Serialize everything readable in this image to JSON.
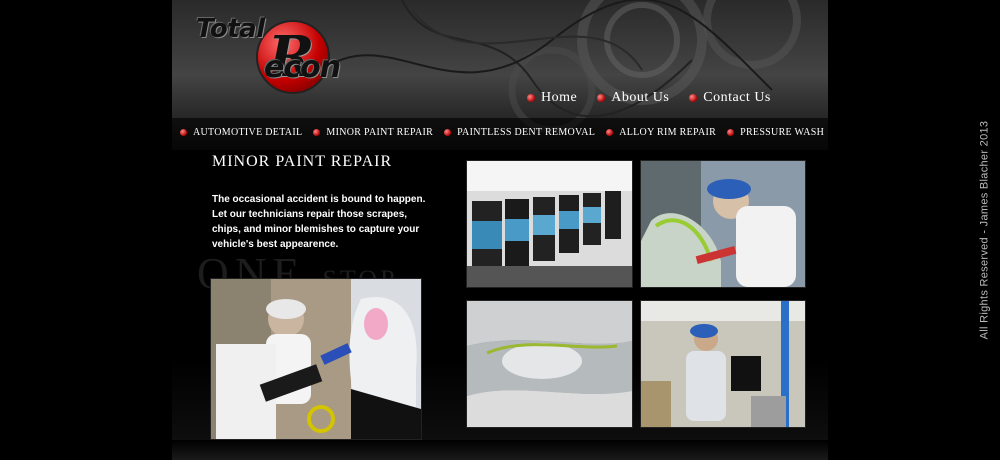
{
  "logo": {
    "line1": "Total",
    "r_letter": "R",
    "line2": "econ"
  },
  "main_nav": [
    {
      "label": "Home"
    },
    {
      "label": "About Us"
    },
    {
      "label": "Contact Us"
    }
  ],
  "services_nav": [
    {
      "label": "AUTOMOTIVE DETAIL"
    },
    {
      "label": "MINOR PAINT REPAIR"
    },
    {
      "label": "PAINTLESS DENT REMOVAL"
    },
    {
      "label": "ALLOY RIM REPAIR"
    },
    {
      "label": "PRESSURE WASH"
    }
  ],
  "content": {
    "heading": "MINOR PAINT REPAIR",
    "intro": "The occasional accident is bound to happen. Let our technicians repair those scrapes, chips, and minor blemishes to capture your vehicle's best appearence.",
    "slogan_big": "ONE",
    "slogan_small": "STOP"
  },
  "copyright": "All Rights Reserved - James Blacher 2013",
  "colors": {
    "accent_red": "#c40000",
    "text": "#ffffff",
    "background": "#000000"
  }
}
